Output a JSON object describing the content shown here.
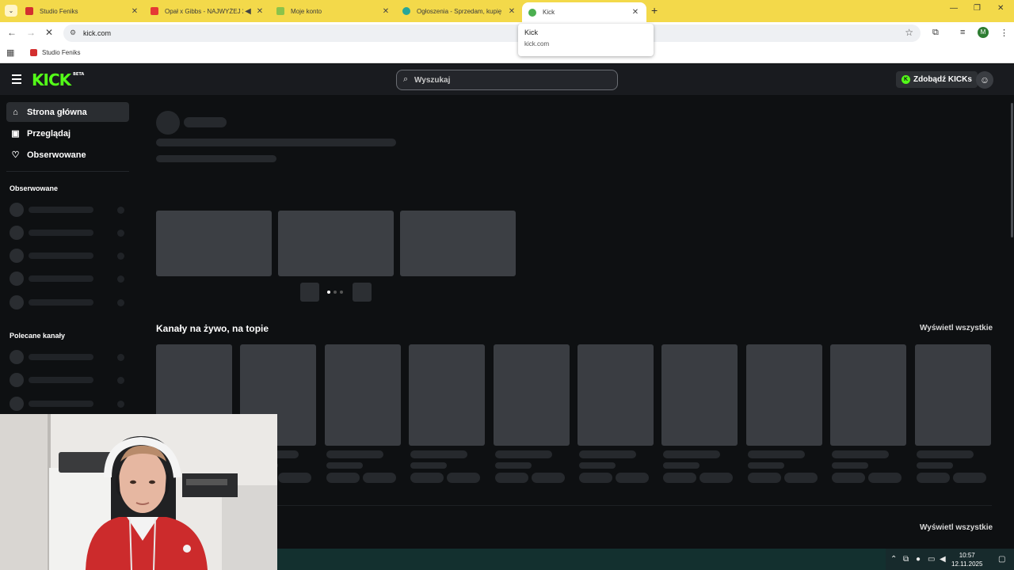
{
  "browser": {
    "tabs": [
      {
        "title": "Studio Feniks",
        "favicon_color": "#d32f2f",
        "active": false
      },
      {
        "title": "Opał x Gibbs - NAJWYŻEJ 2",
        "favicon_color": "#e53935",
        "active": false,
        "audio": true
      },
      {
        "title": "Moje konto",
        "favicon_color": "#8bc34a",
        "active": false
      },
      {
        "title": "Ogłoszenia - Sprzedam, kupię",
        "favicon_color": "#26a69a",
        "active": false
      },
      {
        "title": "Kick",
        "favicon_color": "#4caf50",
        "active": true
      }
    ],
    "url": "kick.com",
    "bookmark": "Studio Feniks",
    "profile_initial": "M",
    "tooltip": {
      "title": "Kick",
      "domain": "kick.com"
    }
  },
  "kick": {
    "logo": "KICK",
    "logo_badge": "BETA",
    "search_placeholder": "Wyszukaj",
    "kicks_button": "Zdobądź KICKs",
    "brand_color": "#53fc18",
    "nav": [
      {
        "label": "Strona główna",
        "icon": "home-icon",
        "active": true
      },
      {
        "label": "Przeglądaj",
        "icon": "browse-icon",
        "active": false
      },
      {
        "label": "Obserwowane",
        "icon": "heart-icon",
        "active": false
      }
    ],
    "sections": {
      "followed_heading": "Obserwowane",
      "recommended_heading": "Polecane kanały",
      "live_title": "Kanały na żywo, na topie",
      "see_all_1": "Wyświetl wszystkie",
      "see_all_2": "Wyświetl wszystkie"
    }
  },
  "taskbar": {
    "time": "10:57",
    "date": "12.11.2025"
  }
}
